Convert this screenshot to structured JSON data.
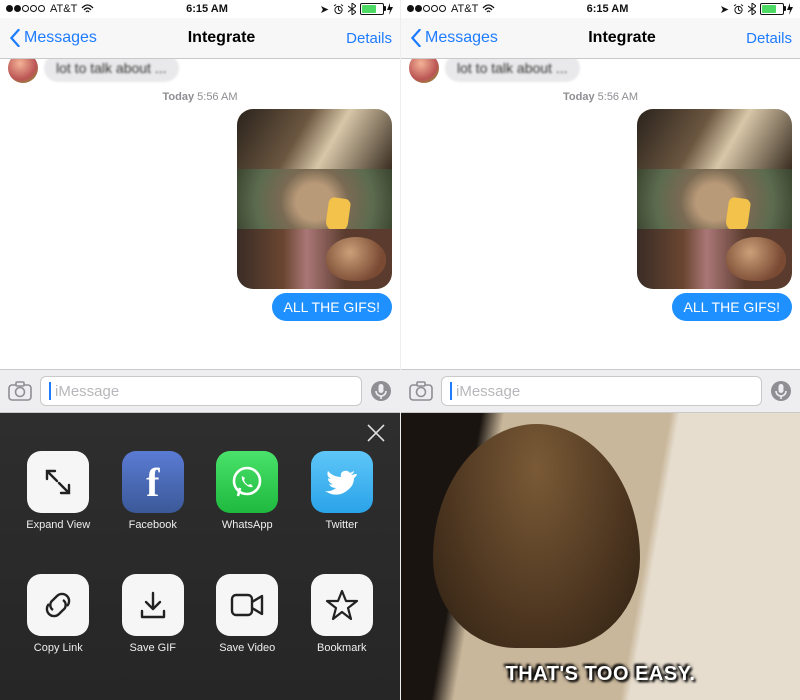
{
  "status": {
    "carrier": "AT&T",
    "time": "6:15 AM",
    "wifi": "wifi-icon",
    "loc": "➤",
    "alarm": "⏰",
    "bt": "bt"
  },
  "nav": {
    "back": "Messages",
    "title": "Integrate",
    "details": "Details"
  },
  "chat": {
    "old": "lot to talk about ...",
    "ts_day": "Today",
    "ts_time": "5:56 AM",
    "bubble": "ALL THE GIFS!"
  },
  "input": {
    "placeholder": "iMessage"
  },
  "share": {
    "items": [
      {
        "k": "expand",
        "label": "Expand View"
      },
      {
        "k": "fb",
        "label": "Facebook"
      },
      {
        "k": "wa",
        "label": "WhatsApp"
      },
      {
        "k": "tw",
        "label": "Twitter"
      },
      {
        "k": "link",
        "label": "Copy Link"
      },
      {
        "k": "sgif",
        "label": "Save GIF"
      },
      {
        "k": "svid",
        "label": "Save Video"
      },
      {
        "k": "bm",
        "label": "Bookmark"
      }
    ]
  },
  "gif": {
    "caption": "THAT'S TOO EASY."
  }
}
